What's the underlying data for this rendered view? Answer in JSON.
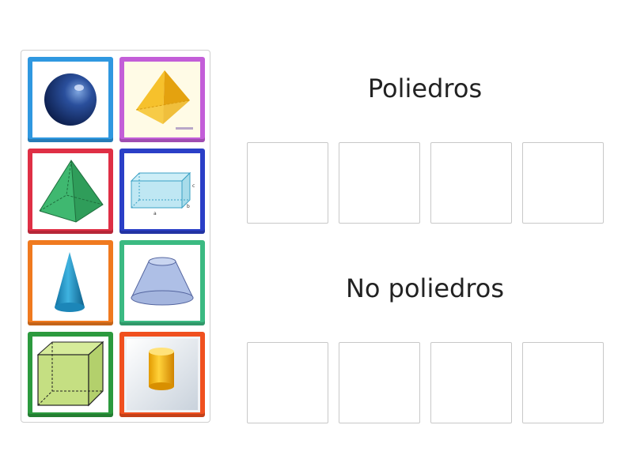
{
  "groups": {
    "polyhedra": {
      "title": "Poliedros"
    },
    "non_polyhedra": {
      "title": "No poliedros"
    }
  },
  "tiles": [
    {
      "shape": "sphere",
      "border_color": "#2f98e0"
    },
    {
      "shape": "tetrahedron",
      "border_color": "#c35ed8"
    },
    {
      "shape": "pyramid",
      "border_color": "#df2f45"
    },
    {
      "shape": "rectangular-prism",
      "border_color": "#2a3fc7"
    },
    {
      "shape": "cone",
      "border_color": "#f07a1f"
    },
    {
      "shape": "frustum",
      "border_color": "#3bba82"
    },
    {
      "shape": "cube",
      "border_color": "#2c9a3e"
    },
    {
      "shape": "cylinder",
      "border_color": "#f0501f"
    }
  ],
  "prism_labels": {
    "a": "a",
    "b": "b",
    "c": "c"
  }
}
